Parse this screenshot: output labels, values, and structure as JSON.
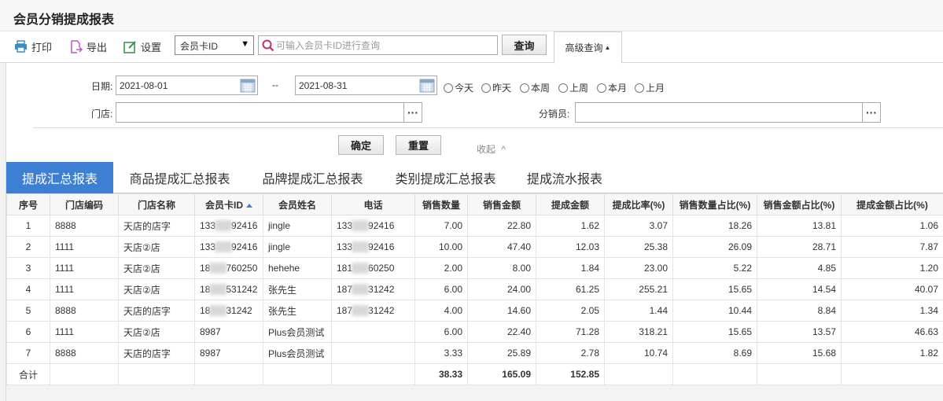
{
  "app_title": "会员分销提成报表",
  "toolbar": {
    "print_label": "打印",
    "export_label": "导出",
    "settings_label": "设置",
    "search_field_value": "会员卡ID",
    "search_placeholder": "可输入会员卡ID进行查询",
    "query_label": "查询",
    "advanced_query_label": "高级查询",
    "advanced_query_arrow": "▲"
  },
  "filter": {
    "date_label": "日期:",
    "date_from": "2021-08-01",
    "date_sep": "--",
    "date_to": "2021-08-31",
    "quick_ranges": [
      "今天",
      "昨天",
      "本周",
      "上周",
      "本月",
      "上月"
    ],
    "store_label": "门店:",
    "store_value": "",
    "distributor_label": "分销员:",
    "distributor_value": "",
    "confirm_label": "确定",
    "reset_label": "重置",
    "collapse_label": "收起",
    "collapse_arrow": "^"
  },
  "tabs": [
    "提成汇总报表",
    "商品提成汇总报表",
    "品牌提成汇总报表",
    "类别提成汇总报表",
    "提成流水报表"
  ],
  "active_tab": 0,
  "colors": {
    "accent": "#3c7fd3",
    "tab_active_bg": "#3c7fd3"
  },
  "table": {
    "columns": [
      "序号",
      "门店编码",
      "门店名称",
      "会员卡ID",
      "会员姓名",
      "电话",
      "销售数量",
      "销售金额",
      "提成金额",
      "提成比率(%)",
      "销售数量占比(%)",
      "销售金额占比(%)",
      "提成金额占比(%)"
    ],
    "sorted_column": "会员卡ID",
    "sort_direction": "asc",
    "rows": [
      {
        "no": "1",
        "store_code": "8888",
        "store_name": "天店的店字",
        "card_a": "133",
        "card_b": "92416",
        "member": "jingle",
        "phone_a": "133",
        "phone_b": "92416",
        "qty": "7.00",
        "amount": "22.80",
        "commission": "1.62",
        "rate": "3.07",
        "qty_pct": "18.26",
        "amount_pct": "13.81",
        "comm_pct": "1.06"
      },
      {
        "no": "2",
        "store_code": "1111",
        "store_name": "天店②店",
        "card_a": "133",
        "card_b": "92416",
        "member": "jingle",
        "phone_a": "133",
        "phone_b": "92416",
        "qty": "10.00",
        "amount": "47.40",
        "commission": "12.03",
        "rate": "25.38",
        "qty_pct": "26.09",
        "amount_pct": "28.71",
        "comm_pct": "7.87"
      },
      {
        "no": "3",
        "store_code": "1111",
        "store_name": "天店②店",
        "card_a": "18",
        "card_b": "760250",
        "member": "hehehe",
        "phone_a": "181",
        "phone_b": "60250",
        "qty": "2.00",
        "amount": "8.00",
        "commission": "1.84",
        "rate": "23.00",
        "qty_pct": "5.22",
        "amount_pct": "4.85",
        "comm_pct": "1.20"
      },
      {
        "no": "4",
        "store_code": "1111",
        "store_name": "天店②店",
        "card_a": "18",
        "card_b": "531242",
        "member": "张先生",
        "phone_a": "187",
        "phone_b": "31242",
        "qty": "6.00",
        "amount": "24.00",
        "commission": "61.25",
        "rate": "255.21",
        "qty_pct": "15.65",
        "amount_pct": "14.54",
        "comm_pct": "40.07"
      },
      {
        "no": "5",
        "store_code": "8888",
        "store_name": "天店的店字",
        "card_a": "18",
        "card_b": "31242",
        "member": "张先生",
        "phone_a": "187",
        "phone_b": "31242",
        "qty": "4.00",
        "amount": "14.60",
        "commission": "2.05",
        "rate": "1.44",
        "qty_pct": "10.44",
        "amount_pct": "8.84",
        "comm_pct": "1.34"
      },
      {
        "no": "6",
        "store_code": "1111",
        "store_name": "天店②店",
        "card_a": "8987",
        "card_b": "",
        "member": "Plus会员测试",
        "phone_a": "",
        "phone_b": "",
        "qty": "6.00",
        "amount": "22.40",
        "commission": "71.28",
        "rate": "318.21",
        "qty_pct": "15.65",
        "amount_pct": "13.57",
        "comm_pct": "46.63"
      },
      {
        "no": "7",
        "store_code": "8888",
        "store_name": "天店的店字",
        "card_a": "8987",
        "card_b": "",
        "member": "Plus会员测试",
        "phone_a": "",
        "phone_b": "",
        "qty": "3.33",
        "amount": "25.89",
        "commission": "2.78",
        "rate": "10.74",
        "qty_pct": "8.69",
        "amount_pct": "15.68",
        "comm_pct": "1.82"
      }
    ],
    "total_label": "合计",
    "total_qty": "38.33",
    "total_amount": "165.09",
    "total_commission": "152.85"
  }
}
